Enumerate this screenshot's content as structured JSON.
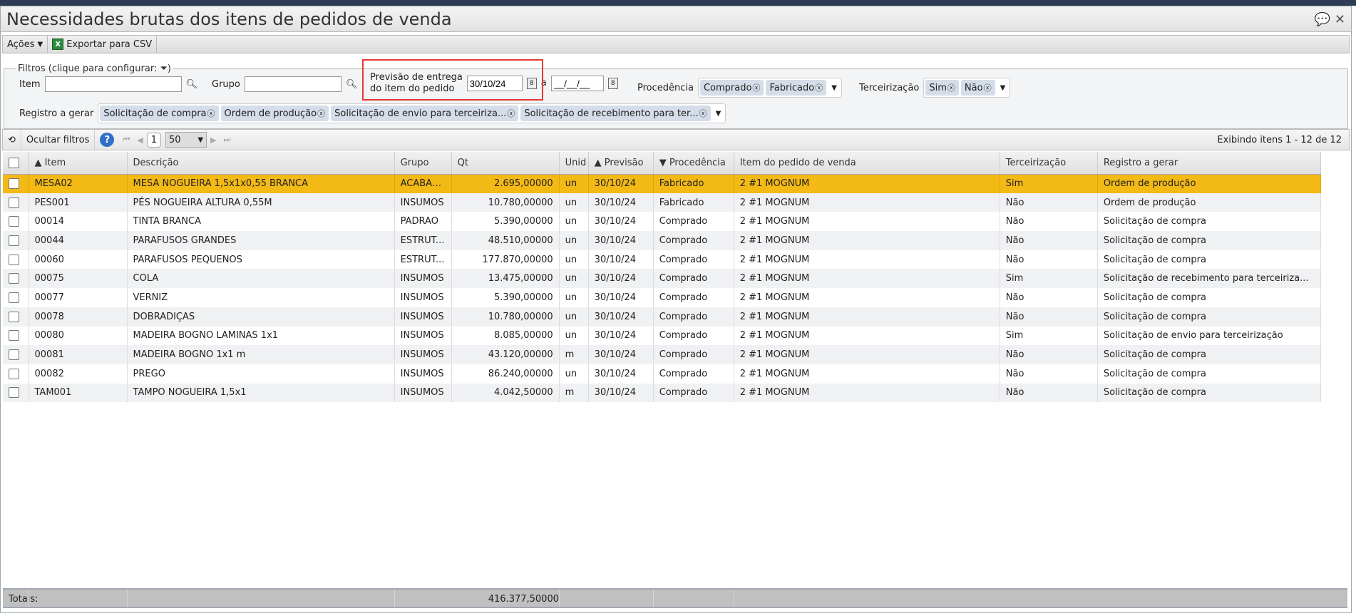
{
  "window": {
    "title": "Necessidades brutas dos itens de pedidos de venda",
    "icons": [
      "comment-icon",
      "close-icon"
    ]
  },
  "toolbar": {
    "actions": "Ações",
    "export": "Exportar para CSV"
  },
  "filters": {
    "legend": "Filtros (clique para configurar:",
    "legend_end": ")",
    "item_label": "Item",
    "item_value": "",
    "grupo_label": "Grupo",
    "grupo_value": "",
    "previsao_label_1": "Previsão de entrega",
    "previsao_label_2": "do item do pedido",
    "previsao_from": "30/10/24",
    "to_label": "a",
    "previsao_to": "__/__/__",
    "procedencia_label": "Procedência",
    "procedencia": [
      "Comprado",
      "Fabricado"
    ],
    "terceirizacao_label": "Terceirização",
    "terceirizacao": [
      "Sim",
      "Não"
    ],
    "registro_label": "Registro a gerar",
    "registro": [
      "Solicitação de compra",
      "Ordem de produção",
      "Solicitação de envio para terceiriza...",
      "Solicitação de recebimento para ter..."
    ]
  },
  "gridbar": {
    "hide_filters": "Ocultar filtros",
    "help": "?",
    "page": "1",
    "page_size": "50",
    "count": "Exibindo itens 1 - 12 de 12"
  },
  "columns": [
    "▲ Item",
    "Descrição",
    "Grupo",
    "Qt",
    "Unid",
    "▲ Previsão",
    "▼ Procedência",
    "Item do pedido de venda",
    "Terceirização",
    "Registro a gerar"
  ],
  "rows": [
    [
      "MESA02",
      "MESA NOGUEIRA 1,5x1x0,55 BRANCA",
      "ACABADO",
      "2.695,00000",
      "un",
      "30/10/24",
      "Fabricado",
      "2 #1 MOGNUM",
      "Sim",
      "Ordem de produção"
    ],
    [
      "PES001",
      "PÉS NOGUEIRA ALTURA 0,55M",
      "INSUMOS",
      "10.780,00000",
      "un",
      "30/10/24",
      "Fabricado",
      "2 #1 MOGNUM",
      "Não",
      "Ordem de produção"
    ],
    [
      "00014",
      "TINTA BRANCA",
      "PADRAO",
      "5.390,00000",
      "un",
      "30/10/24",
      "Comprado",
      "2 #1 MOGNUM",
      "Não",
      "Solicitação de compra"
    ],
    [
      "00044",
      "PARAFUSOS GRANDES",
      "ESTRUT...",
      "48.510,00000",
      "un",
      "30/10/24",
      "Comprado",
      "2 #1 MOGNUM",
      "Não",
      "Solicitação de compra"
    ],
    [
      "00060",
      "PARAFUSOS PEQUENOS",
      "ESTRUT...",
      "177.870,00000",
      "un",
      "30/10/24",
      "Comprado",
      "2 #1 MOGNUM",
      "Não",
      "Solicitação de compra"
    ],
    [
      "00075",
      "COLA",
      "INSUMOS",
      "13.475,00000",
      "un",
      "30/10/24",
      "Comprado",
      "2 #1 MOGNUM",
      "Sim",
      "Solicitação de recebimento para terceiriza..."
    ],
    [
      "00077",
      "VERNIZ",
      "INSUMOS",
      "5.390,00000",
      "un",
      "30/10/24",
      "Comprado",
      "2 #1 MOGNUM",
      "Não",
      "Solicitação de compra"
    ],
    [
      "00078",
      "DOBRADIÇAS",
      "INSUMOS",
      "10.780,00000",
      "un",
      "30/10/24",
      "Comprado",
      "2 #1 MOGNUM",
      "Não",
      "Solicitação de compra"
    ],
    [
      "00080",
      "MADEIRA BOGNO LAMINAS 1x1",
      "INSUMOS",
      "8.085,00000",
      "un",
      "30/10/24",
      "Comprado",
      "2 #1 MOGNUM",
      "Sim",
      "Solicitação de envio para terceirização"
    ],
    [
      "00081",
      "MADEIRA BOGNO 1x1 m",
      "INSUMOS",
      "43.120,00000",
      "m",
      "30/10/24",
      "Comprado",
      "2 #1 MOGNUM",
      "Não",
      "Solicitação de compra"
    ],
    [
      "00082",
      "PREGO",
      "INSUMOS",
      "86.240,00000",
      "un",
      "30/10/24",
      "Comprado",
      "2 #1 MOGNUM",
      "Não",
      "Solicitação de compra"
    ],
    [
      "TAM001",
      "TAMPO NOGUEIRA 1,5x1",
      "INSUMOS",
      "4.042,50000",
      "m",
      "30/10/24",
      "Comprado",
      "2 #1 MOGNUM",
      "Não",
      "Solicitação de compra"
    ]
  ],
  "totals": {
    "label": "Totais:",
    "qt": "416.377,50000"
  },
  "colors": {
    "selected_row": "#f3b915",
    "highlight_box": "#e53935"
  }
}
